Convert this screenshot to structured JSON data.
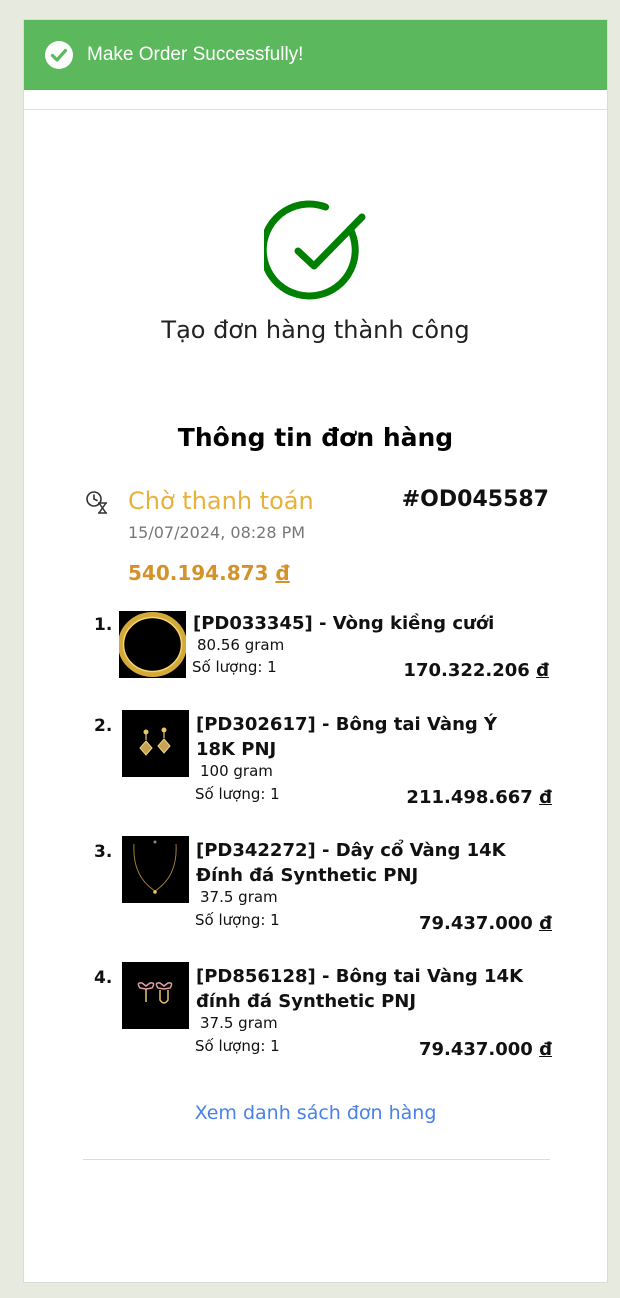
{
  "toast": {
    "message": "Make Order Successfully!",
    "icon": "check-circle-icon",
    "color": "#5cb85c"
  },
  "success": {
    "icon": "check-circle-icon",
    "color": "#008000",
    "title": "Tạo đơn hàng thành công"
  },
  "order": {
    "section_title": "Thông tin đơn hàng",
    "status_icon": "hourglass-clock-icon",
    "status": "Chờ thanh toán",
    "status_color": "#e6b23a",
    "id": "#OD045587",
    "date": "15/07/2024, 08:28 PM",
    "total_amount": "540.194.873",
    "total_currency": "đ",
    "total_color": "#d4922a"
  },
  "items": [
    {
      "index": "1.",
      "name": "[PD033345] - Vòng kiềng cưới",
      "weight": "80.56 gram",
      "qty": "Số lượng: 1",
      "price": "170.322.206",
      "currency": "đ",
      "image": "gold-bangle"
    },
    {
      "index": "2.",
      "name": "[PD302617] - Bông tai Vàng Ý 18K PNJ",
      "weight": "100 gram",
      "qty": "Số lượng: 1",
      "price": "211.498.667",
      "currency": "đ",
      "image": "gold-drop-earrings"
    },
    {
      "index": "3.",
      "name": "[PD342272] - Dây cổ Vàng 14K Đính đá Synthetic PNJ",
      "weight": "37.5 gram",
      "qty": "Số lượng: 1",
      "price": "79.437.000",
      "currency": "đ",
      "image": "gold-necklace"
    },
    {
      "index": "4.",
      "name": "[PD856128] - Bông tai Vàng 14K đính đá Synthetic PNJ",
      "weight": "37.5 gram",
      "qty": "Số lượng: 1",
      "price": "79.437.000",
      "currency": "đ",
      "image": "bow-earrings"
    }
  ],
  "links": {
    "orders_list": "Xem danh sách đơn hàng"
  }
}
